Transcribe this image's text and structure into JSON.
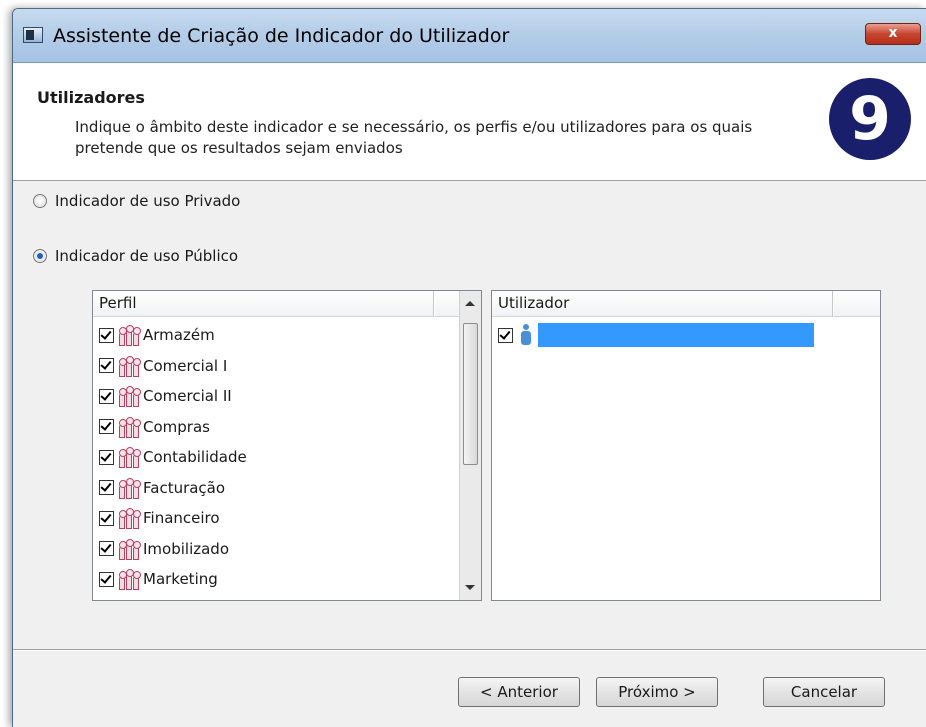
{
  "window": {
    "title": "Assistente de Criação de Indicador do Utilizador",
    "close_label": "x"
  },
  "header": {
    "title": "Utilizadores",
    "description": "Indique o âmbito deste indicador e se necessário, os perfis e/ou utilizadores para os quais pretende que os resultados sejam enviados",
    "logo_icon": "primavera-9-logo",
    "logo_text": "9"
  },
  "scope": {
    "private_label": "Indicador de uso Privado",
    "public_label": "Indicador de uso Público",
    "selected": "public"
  },
  "profiles": {
    "column_header": "Perfil",
    "icon": "user-group-icon",
    "items": [
      {
        "label": "Armazém",
        "checked": true
      },
      {
        "label": "Comercial I",
        "checked": true
      },
      {
        "label": "Comercial II",
        "checked": true
      },
      {
        "label": "Compras",
        "checked": true
      },
      {
        "label": "Contabilidade",
        "checked": true
      },
      {
        "label": "Facturação",
        "checked": true
      },
      {
        "label": "Financeiro",
        "checked": true
      },
      {
        "label": "Imobilizado",
        "checked": true
      },
      {
        "label": "Marketing",
        "checked": true
      }
    ]
  },
  "users": {
    "column_header": "Utilizador",
    "icon": "user-icon",
    "items": [
      {
        "label": "",
        "checked": true,
        "selected": true
      }
    ]
  },
  "buttons": {
    "back": "< Anterior",
    "next": "Próximo >",
    "cancel": "Cancelar"
  },
  "colors": {
    "titlebar": "#b4cde8",
    "selection": "#3399ff",
    "logo": "#1a1f6b",
    "close": "#c7442f"
  }
}
